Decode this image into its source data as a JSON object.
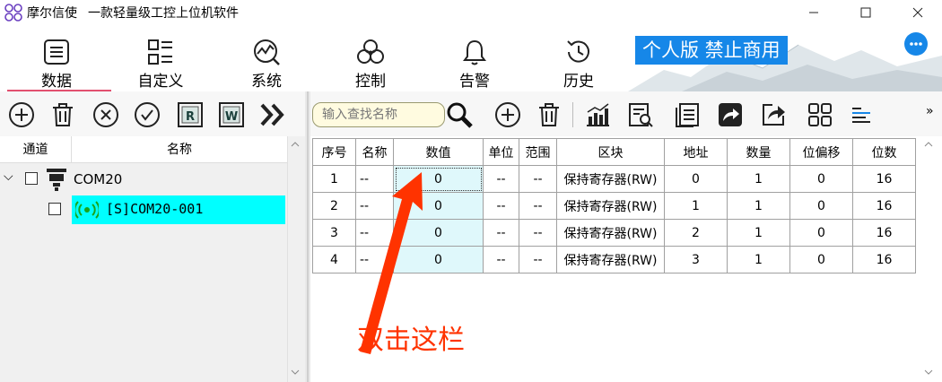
{
  "window": {
    "app_name": "摩尔信使",
    "subtitle": "一款轻量级工控上位机软件",
    "controls": [
      "minimize-icon",
      "maximize-icon",
      "close-icon"
    ]
  },
  "nav": {
    "tabs": [
      {
        "label": "数据",
        "icon": "document-icon",
        "active": true
      },
      {
        "label": "自定义",
        "icon": "list-icon"
      },
      {
        "label": "系统",
        "icon": "chart-search-icon"
      },
      {
        "label": "控制",
        "icon": "biohazard-icon"
      },
      {
        "label": "告警",
        "icon": "bell-icon"
      },
      {
        "label": "历史",
        "icon": "history-icon"
      }
    ],
    "badge": "个人版  禁止商用",
    "accent": "#1687e8",
    "active_underline": "#e2506f"
  },
  "toolbar_left": {
    "buttons": [
      "add-icon",
      "delete-icon",
      "remove-icon",
      "check-icon",
      "read-icon",
      "write-icon",
      "double-chevron-right-icon"
    ],
    "read_letter": "R",
    "write_letter": "W"
  },
  "toolbar_right": {
    "search_placeholder": "输入查找名称",
    "buttons": [
      "search-icon",
      "add-icon",
      "delete-icon",
      "bar-chart-icon",
      "report-search-icon",
      "document-icon",
      "forward-icon",
      "share-icon",
      "grid-icon",
      "align-icon"
    ],
    "overflow": "»"
  },
  "tree": {
    "headers": [
      "通道",
      "名称"
    ],
    "channel": {
      "label": "COM20",
      "expand": "⌵"
    },
    "device": {
      "label": "[S]COM20-001",
      "highlight": "#00ffff"
    }
  },
  "table": {
    "columns": [
      "序号",
      "名称",
      "数值",
      "单位",
      "范围",
      "区块",
      "地址",
      "数量",
      "位偏移",
      "位数"
    ],
    "rows": [
      [
        "1",
        "--",
        "0",
        "--",
        "--",
        "保持寄存器(RW)",
        "0",
        "1",
        "0",
        "16"
      ],
      [
        "2",
        "--",
        "0",
        "--",
        "--",
        "保持寄存器(RW)",
        "1",
        "1",
        "0",
        "16"
      ],
      [
        "3",
        "--",
        "0",
        "--",
        "--",
        "保持寄存器(RW)",
        "2",
        "1",
        "0",
        "16"
      ],
      [
        "4",
        "--",
        "0",
        "--",
        "--",
        "保持寄存器(RW)",
        "3",
        "1",
        "0",
        "16"
      ]
    ]
  },
  "annotation": {
    "text": "双击这栏",
    "color": "#ff3300"
  }
}
